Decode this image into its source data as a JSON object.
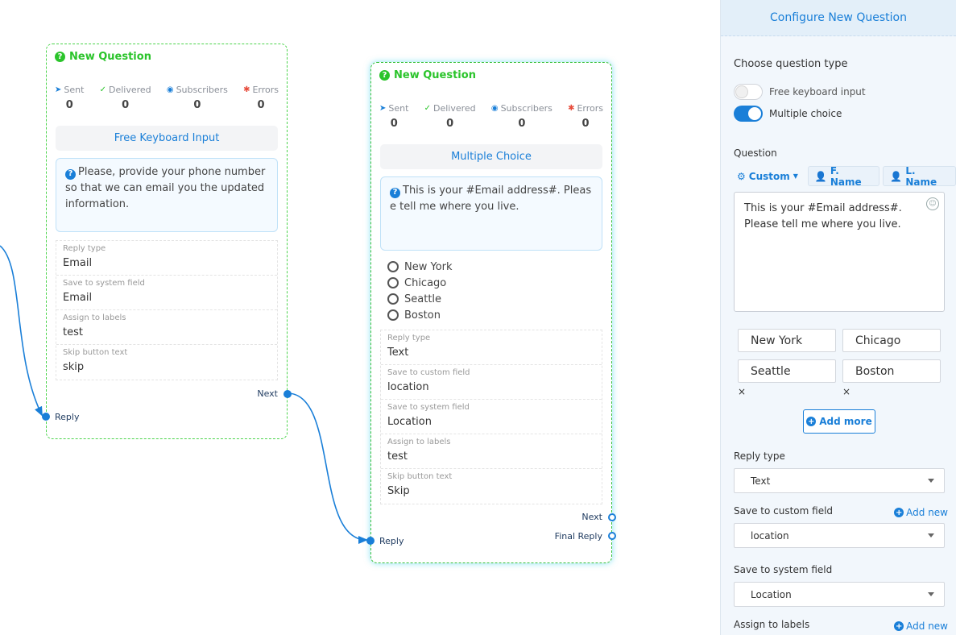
{
  "node1": {
    "title": "New Question",
    "stats": [
      {
        "label": "Sent",
        "value": "0",
        "icon": "paper-plane-icon"
      },
      {
        "label": "Delivered",
        "value": "0",
        "icon": "check-circle-icon"
      },
      {
        "label": "Subscribers",
        "value": "0",
        "icon": "user-circle-icon"
      },
      {
        "label": "Errors",
        "value": "0",
        "icon": "bug-icon"
      }
    ],
    "type": "Free Keyboard Input",
    "message": "Please, provide your phone number so that we can email you the updated information.",
    "fields": [
      {
        "label": "Reply type",
        "value": "Email"
      },
      {
        "label": "Save to system field",
        "value": "Email"
      },
      {
        "label": "Assign to labels",
        "value": "test"
      },
      {
        "label": "Skip button text",
        "value": "skip"
      }
    ],
    "next_label": "Next",
    "reply_label": "Reply"
  },
  "node2": {
    "title": "New Question",
    "stats": [
      {
        "label": "Sent",
        "value": "0",
        "icon": "paper-plane-icon"
      },
      {
        "label": "Delivered",
        "value": "0",
        "icon": "check-circle-icon"
      },
      {
        "label": "Subscribers",
        "value": "0",
        "icon": "user-circle-icon"
      },
      {
        "label": "Errors",
        "value": "0",
        "icon": "bug-icon"
      }
    ],
    "type": "Multiple Choice",
    "message": "This is your #Email address#. Please tell me where you live.",
    "choices": [
      "New York",
      "Chicago",
      "Seattle",
      "Boston"
    ],
    "fields": [
      {
        "label": "Reply type",
        "value": "Text"
      },
      {
        "label": "Save to custom field",
        "value": "location"
      },
      {
        "label": "Save to system field",
        "value": "Location"
      },
      {
        "label": "Assign to labels",
        "value": "test"
      },
      {
        "label": "Skip button text",
        "value": "Skip"
      }
    ],
    "next_label": "Next",
    "final_reply_label": "Final Reply",
    "reply_label": "Reply"
  },
  "panel": {
    "title": "Configure New Question",
    "choose_type_label": "Choose question type",
    "toggle_free": "Free keyboard input",
    "toggle_multiple": "Multiple choice",
    "question_label": "Question",
    "tag_custom": "Custom",
    "tag_fname": "F. Name",
    "tag_lname": "L. Name",
    "question_text": "This is your #Email address#. Please tell me where you live.",
    "options": [
      "New York",
      "Chicago",
      "Seattle",
      "Boston"
    ],
    "remove_mark": "×",
    "add_more": "Add more",
    "reply_type_label": "Reply type",
    "reply_type_value": "Text",
    "custom_field_label": "Save to custom field",
    "custom_field_value": "location",
    "add_new": "Add new",
    "system_field_label": "Save to system field",
    "system_field_value": "Location",
    "assign_labels_label": "Assign to labels"
  },
  "colors": {
    "accent": "#1a7fd8",
    "node_green": "#2bc42b",
    "error_red": "#e74c3c"
  }
}
